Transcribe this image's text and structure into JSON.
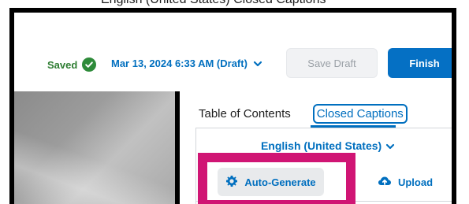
{
  "top_strip": {
    "partial_text": "English (United States) Closed Captions"
  },
  "header": {
    "saved_label": "Saved",
    "date_label": "Mar 13, 2024 6:33 AM (Draft)",
    "save_draft_label": "Save Draft",
    "finish_label": "Finish"
  },
  "tabs": {
    "table_of_contents": "Table of Contents",
    "closed_captions": "Closed Captions"
  },
  "captions_panel": {
    "language": "English (United States)",
    "auto_generate_label": "Auto-Generate",
    "upload_label": "Upload"
  },
  "colors": {
    "accent_blue": "#006fbf",
    "finish_button": "#0570c4",
    "saved_green": "#2e8b3a",
    "highlight_magenta": "#d01574"
  },
  "icons": {
    "saved": "check-circle-icon",
    "dropdown": "chevron-down-icon",
    "auto_generate": "gear-icon",
    "upload": "cloud-upload-icon"
  }
}
